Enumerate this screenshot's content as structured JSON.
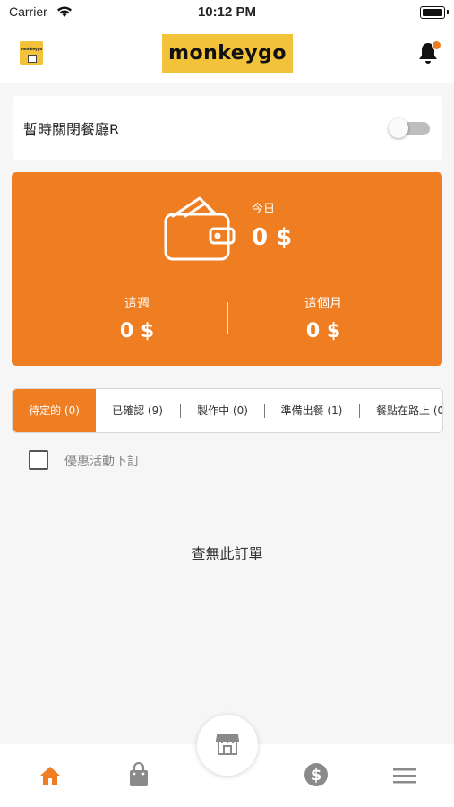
{
  "status_bar": {
    "carrier": "Carrier",
    "time": "10:12 PM"
  },
  "header": {
    "brand": "monkeygo",
    "avatar_text": "monkeygo",
    "notification_dot": true
  },
  "restaurant_toggle": {
    "label": "暫時關閉餐廳R",
    "enabled": false
  },
  "earnings": {
    "today_label": "今日",
    "today_value": "0 $",
    "week_label": "這週",
    "week_value": "0 $",
    "month_label": "這個月",
    "month_value": "0 $"
  },
  "tabs": [
    {
      "label": "待定的 (0)",
      "active": true
    },
    {
      "label": "已確認 (9)",
      "active": false
    },
    {
      "label": "製作中 (0)",
      "active": false
    },
    {
      "label": "準備出餐 (1)",
      "active": false
    },
    {
      "label": "餐點在路上 (0",
      "active": false
    }
  ],
  "promo_filter": {
    "label": "優惠活動下訂",
    "checked": false
  },
  "empty_message": "查無此訂單",
  "bottom_nav": {
    "items": [
      "home-icon",
      "shopping-bag-icon",
      "store-icon",
      "dollar-icon",
      "menu-icon"
    ],
    "active": "home-icon"
  },
  "colors": {
    "accent": "#ef7d22",
    "brand_bg": "#f2c23a",
    "inactive_icon": "#8a8a8a"
  }
}
